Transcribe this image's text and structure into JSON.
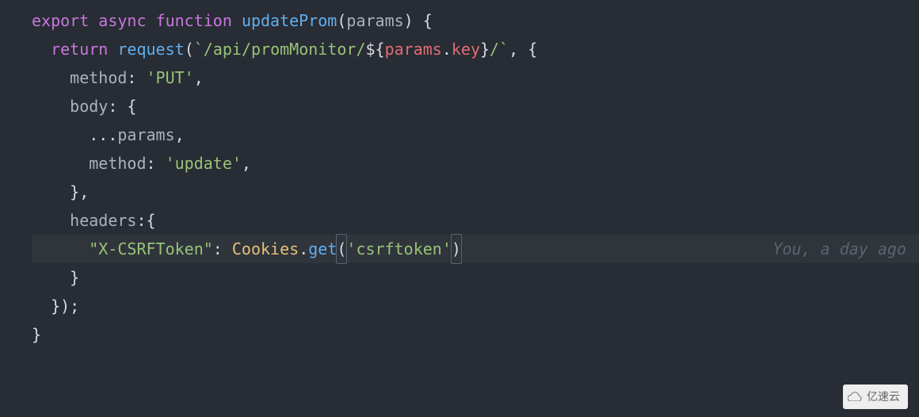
{
  "code": {
    "line1": {
      "export": "export",
      "async": "async",
      "function": "function",
      "funcname": "updateProm",
      "lparen": "(",
      "param": "params",
      "rparen": ")",
      "lbrace": " {"
    },
    "line2": {
      "return": "return",
      "call": "request",
      "lparen": "(",
      "backtick1": "`",
      "str1": "/api/promMonitor/",
      "tmpl_open": "${",
      "tmpl_obj": "params",
      "tmpl_dot": ".",
      "tmpl_prop": "key",
      "tmpl_close": "}",
      "str2": "/",
      "backtick2": "`",
      "comma": ", {"
    },
    "line3": {
      "key": "method",
      "colon": ": ",
      "value": "'PUT'",
      "comma": ","
    },
    "line4": {
      "key": "body",
      "colon": ": {"
    },
    "line5": {
      "spread": "...",
      "obj": "params",
      "comma": ","
    },
    "line6": {
      "key": "method",
      "colon": ": ",
      "value": "'update'",
      "comma": ","
    },
    "line7": {
      "close": "},"
    },
    "line8": {
      "key": "headers",
      "colon": ":{"
    },
    "line9": {
      "hkey": "\"X-CSRFToken\"",
      "colon": ": ",
      "obj": "Cookies",
      "dot": ".",
      "method": "get",
      "lparen": "(",
      "arg": "'csrftoken'",
      "rparen": ")"
    },
    "line10": {
      "close": "}"
    },
    "line11": {
      "close": "});"
    },
    "line12": {
      "close": "}"
    }
  },
  "codelens": "You, a day ago",
  "watermark": "亿速云"
}
